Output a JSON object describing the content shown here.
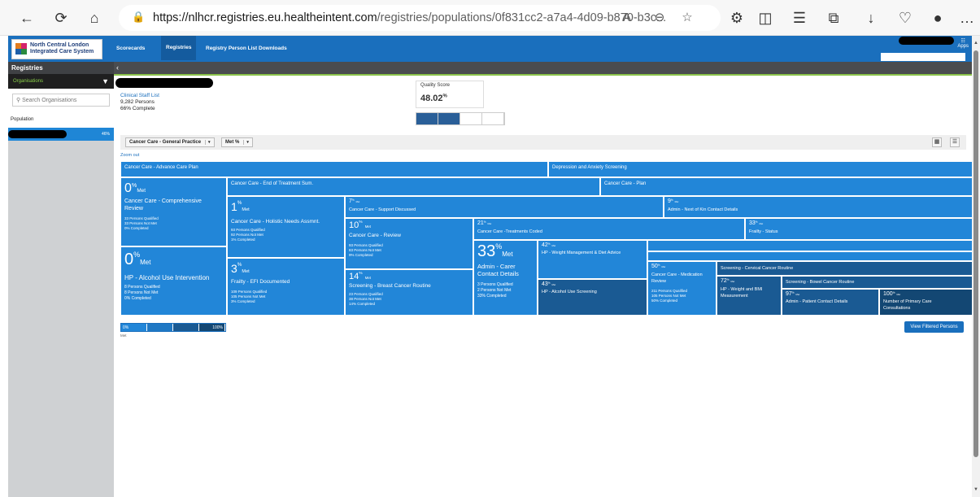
{
  "browser": {
    "url_host": "https://nlhcr.registries.eu.healtheintent.com",
    "url_path": "/registries/populations/0f831cc2-a7a4-4d09-b870-b3c..."
  },
  "app": {
    "logo_line1": "North Central London",
    "logo_line2": "Integrated Care System",
    "nav": [
      "Scorecards",
      "Registries",
      "Registry Person List Downloads"
    ],
    "apps_label": "Apps"
  },
  "sidebar": {
    "title": "Registries",
    "organisations_label": "Organisations",
    "search_placeholder": "Search Organisations",
    "population_label": "Population",
    "org_pct": "46%"
  },
  "summary": {
    "staff_link": "Clinical Staff List",
    "persons": "9,282 Persons",
    "complete": "66% Complete",
    "quality_label": "Quality Score",
    "quality_value": "48.02",
    "quality_unit": "%"
  },
  "filters": {
    "program": "Cancer Care - General Practice",
    "metric": "Met %"
  },
  "zoom_out": "Zoom out",
  "treemap": {
    "advance": "Cancer Care - Advance Care Plan",
    "depression": "Depression and Anxiety Screening",
    "eot": "Cancer Care - End of Treatment Sum.",
    "plan": "Cancer Care - Plan",
    "comp_pct": "0",
    "comp_name1": "Cancer Care - Comprehensive",
    "comp_name2": "Review",
    "comp_s1": "33 Persons Qualified",
    "comp_s2": "33 Persons Not Met",
    "comp_s3": "0% Completed",
    "alc_pct": "0",
    "alc_name": "HP - Alcohol Use Intervention",
    "alc_s1": "8 Persons Qualified",
    "alc_s2": "8 Persons Not Met",
    "alc_s3": "0% Completed",
    "hna_pct": "1",
    "hna_name": "Cancer Care - Holistic Needs Assmnt.",
    "hna_s1": "93 Persons Qualified",
    "hna_s2": "92 Persons Not Met",
    "hna_s3": "1% Completed",
    "efi_pct": "3",
    "efi_name": "Frailty - EFI Documented",
    "efi_s1": "109 Persons Qualified",
    "efi_s2": "105 Persons Not Met",
    "efi_s3": "3% Completed",
    "support_pct": "7",
    "support_name": "Cancer Care - Support Discussed",
    "nok_pct": "9",
    "nok_name": "Admin - Next of Kin Contact Details",
    "review_pct": "10",
    "review_name": "Cancer Care - Review",
    "review_s1": "93 Persons Qualified",
    "review_s2": "83 Persons Not Met",
    "review_s3": "9% Completed",
    "treat_pct": "21",
    "treat_name": "Cancer Care -Treatments Coded",
    "frailty_pct": "33",
    "frailty_name": "Frailty - Status",
    "carer_pct": "33",
    "carer_name1": "Admin - Carer",
    "carer_name2": "Contact Details",
    "carer_s1": "3 Persons Qualified",
    "carer_s2": "2 Persons Not Met",
    "carer_s3": "33% Completed",
    "weight_pct": "42",
    "weight_name": "HP - Weight Management & Diet Advice",
    "alcscr_pct": "43",
    "alcscr_name": "HP - Alcohol Use Screening",
    "breast_pct": "14",
    "breast_name": "Screening - Breast Cancer Routine",
    "breast_s1": "23 Persons Qualified",
    "breast_s2": "38 Persons Not Met",
    "breast_s3": "14% Completed",
    "med_pct": "50",
    "med_name1": "Cancer Care - Medication",
    "med_name2": "Review",
    "med_s1": "211 Persons Qualified",
    "med_s2": "105 Persons Not Met",
    "med_s3": "50% Completed",
    "cervical_name": "Screening - Cervical Cancer Routine",
    "bmi_pct": "72",
    "bmi_name1": "HP - Weight and BMI",
    "bmi_name2": "Measurement",
    "bowel_name": "Screening - Bowel Cancer Routine",
    "patient_pct": "97",
    "patient_name": "Admin - Patient Contact Details",
    "primary_pct": "100",
    "primary_name1": "Number of Primary Care",
    "primary_name2": "Consultations",
    "met_word": "Met",
    "pct_sign": "%"
  },
  "legend": {
    "low": "0%",
    "high": "100%",
    "label": "Met"
  },
  "view_button": "View Filtered Persons"
}
